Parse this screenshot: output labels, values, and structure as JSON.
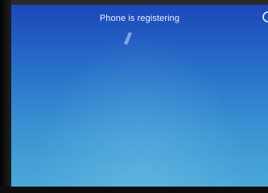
{
  "status": {
    "message": "Phone is registering"
  },
  "icons": {
    "loading": "loading-spinner-icon",
    "corner": "power-icon"
  },
  "colors": {
    "screen_top": "#1c47b8",
    "screen_bottom": "#4aa8d8",
    "text": "#e8f0ff"
  }
}
